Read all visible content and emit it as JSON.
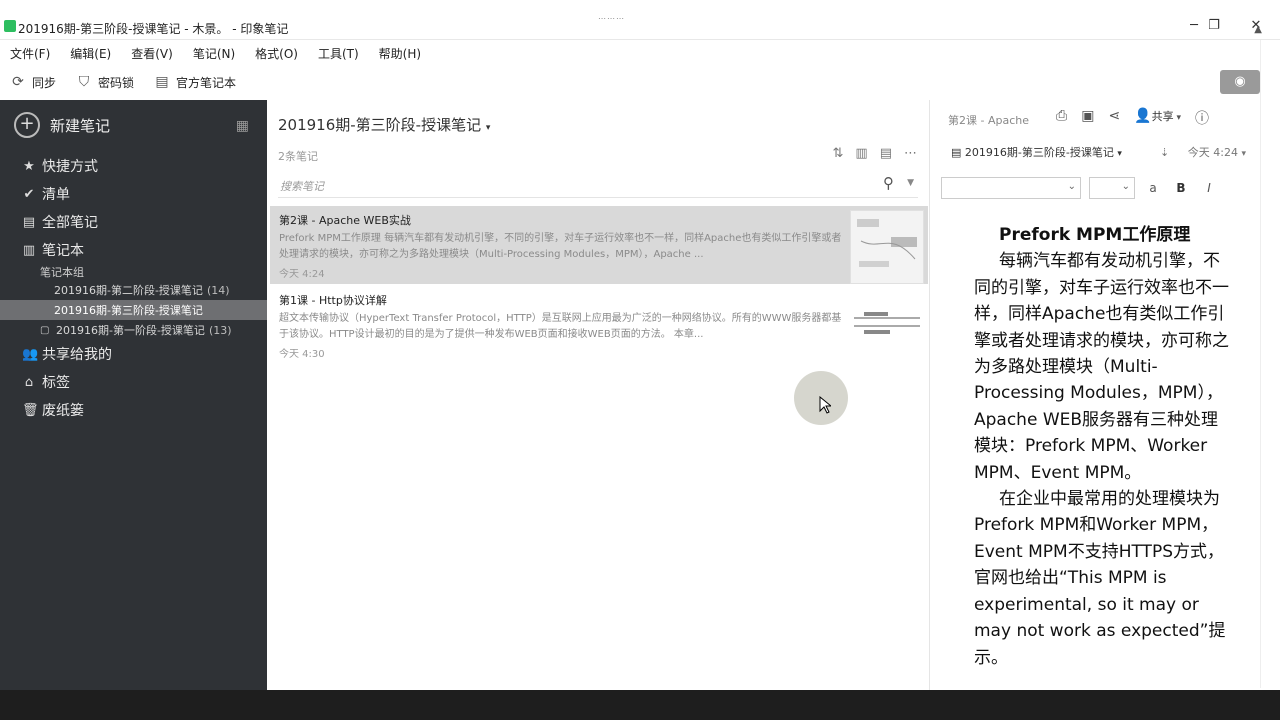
{
  "window": {
    "title": "201916期-第三阶段-授课笔记 - 木景。 - 印象笔记",
    "minimize": "─",
    "maximize": "❐",
    "close": "✕"
  },
  "menu": [
    "文件(F)",
    "编辑(E)",
    "查看(V)",
    "笔记(N)",
    "格式(O)",
    "工具(T)",
    "帮助(H)"
  ],
  "toolbar": {
    "sync": "同步",
    "password": "密码锁",
    "official": "官方笔记本"
  },
  "sidebar": {
    "new_note": "新建笔记",
    "shortcuts": "快捷方式",
    "checklist": "清单",
    "all_notes": "全部笔记",
    "notebooks": "笔记本",
    "notebook_group": "笔记本组",
    "notebook_items": [
      {
        "name": "201916期-第二阶段-授课笔记",
        "count": "(14)"
      },
      {
        "name": "201916期-第三阶段-授课笔记",
        "count": ""
      },
      {
        "name": "201916期-第一阶段-授课笔记",
        "count": "(13)"
      }
    ],
    "shared": "共享给我的",
    "tags": "标签",
    "trash": "废纸篓"
  },
  "notelist": {
    "title": "201916期-第三阶段-授课笔记",
    "count": "2条笔记",
    "search_placeholder": "搜索笔记",
    "notes": [
      {
        "title": "第2课 - Apache WEB实战",
        "snippet": "Prefork MPM工作原理 每辆汽车都有发动机引擎，不同的引擎，对车子运行效率也不一样，同样Apache也有类似工作引擎或者处理请求的模块，亦可称之为多路处理模块（Multi-Processing Modules，MPM），Apache ...",
        "date": "今天 4:24"
      },
      {
        "title": "第1课 - Http协议详解",
        "snippet": "超文本传输协议（HyperText Transfer Protocol，HTTP）是互联网上应用最为广泛的一种网络协议。所有的WWW服务器都基于该协议。HTTP设计最初的目的是为了提供一种发布WEB页面和接收WEB页面的方法。 本章...",
        "date": "今天 4:30"
      }
    ]
  },
  "editor": {
    "breadcrumb": "第2课 - Apache",
    "share": "共享",
    "notebook": "201916期-第三阶段-授课笔记",
    "time": "今天 4:24",
    "heading": "Prefork MPM工作原理",
    "para1": "每辆汽车都有发动机引擎，不同的引擎，对车子运行效率也不一样，同样Apache也有类似工作引擎或者处理请求的模块，亦可称之为多路处理模块（Multi-Processing Modules，MPM），Apache WEB服务器有三种处理模块：Prefork MPM、Worker MPM、Event MPM。",
    "para2": "在企业中最常用的处理模块为Prefork MPM和Worker MPM，Event MPM不支持HTTPS方式，官网也给出“This MPM is experimental, so it may or may not work as expected”提示。"
  },
  "colors": {
    "sidebar_bg": "#2f3236",
    "selected_note_bg": "#d9d9d9",
    "active_notebook_bg": "#6e6f72"
  }
}
